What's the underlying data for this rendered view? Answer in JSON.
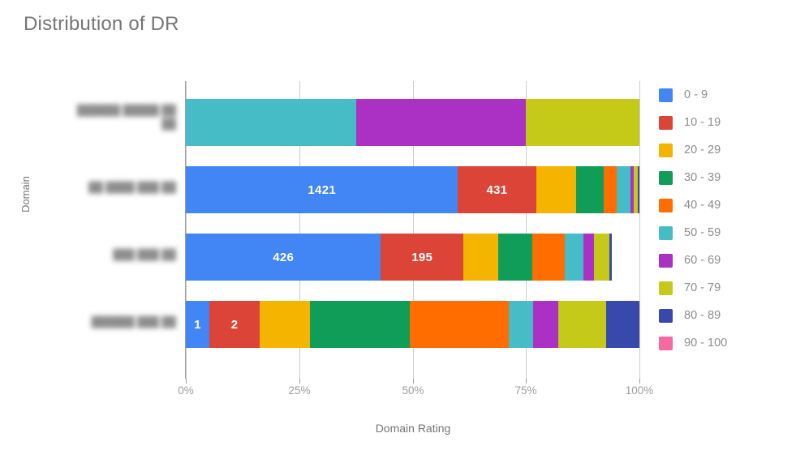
{
  "chart_data": {
    "type": "bar",
    "subtype": "horizontal-stacked-percent",
    "title": "Distribution of DR",
    "xlabel": "Domain Rating",
    "ylabel": "Domain",
    "xlim": [
      0,
      100
    ],
    "xtick_labels": [
      "0%",
      "25%",
      "50%",
      "75%",
      "100%"
    ],
    "xtick_values": [
      0,
      25,
      50,
      75,
      100
    ],
    "grid": true,
    "legend_position": "right",
    "categories": [
      "██████ █████ ██ ██",
      "██ ████ ███ ██",
      "███ ███ ██",
      "██████ ███ ██"
    ],
    "categories_redacted": true,
    "series": [
      {
        "name": "0 - 9",
        "color": "#4285F4",
        "values": [
          0,
          60.0,
          43.0,
          5.2
        ]
      },
      {
        "name": "10 - 19",
        "color": "#DB4437",
        "values": [
          0,
          17.2,
          18.2,
          11.1
        ]
      },
      {
        "name": "20 - 29",
        "color": "#F4B400",
        "values": [
          0,
          8.9,
          7.6,
          11.1
        ]
      },
      {
        "name": "30 - 39",
        "color": "#0F9D58",
        "values": [
          0,
          6.1,
          7.6,
          21.9
        ]
      },
      {
        "name": "40 - 49",
        "color": "#FF6D00",
        "values": [
          0,
          2.8,
          7.2,
          21.9
        ]
      },
      {
        "name": "50 - 59",
        "color": "#46BDC6",
        "values": [
          37.5,
          3.1,
          4.1,
          5.4
        ]
      },
      {
        "name": "60 - 69",
        "color": "#AB30C4",
        "values": [
          37.5,
          0.7,
          2.3,
          5.6
        ]
      },
      {
        "name": "70 - 79",
        "color": "#C5CA18",
        "values": [
          25.0,
          0.9,
          3.4,
          10.4
        ]
      },
      {
        "name": "80 - 89",
        "color": "#3949AB",
        "values": [
          0,
          0.3,
          0.6,
          7.4
        ]
      },
      {
        "name": "90 - 100",
        "color": "#F7699F",
        "values": [
          0,
          0,
          0,
          0
        ]
      }
    ],
    "bar_labels": [
      {
        "row": 1,
        "series": "0 - 9",
        "text": "1421"
      },
      {
        "row": 1,
        "series": "10 - 19",
        "text": "431"
      },
      {
        "row": 2,
        "series": "0 - 9",
        "text": "426"
      },
      {
        "row": 2,
        "series": "10 - 19",
        "text": "195"
      },
      {
        "row": 3,
        "series": "0 - 9",
        "text": "1"
      },
      {
        "row": 3,
        "series": "10 - 19",
        "text": "2"
      }
    ]
  },
  "colors": {
    "title_text": "#757575",
    "axis_text": "#9e9e9e",
    "gridline": "#cccccc",
    "axis_line": "#9e9e9e",
    "background": "#ffffff",
    "bar_label_text": "#ffffff"
  }
}
